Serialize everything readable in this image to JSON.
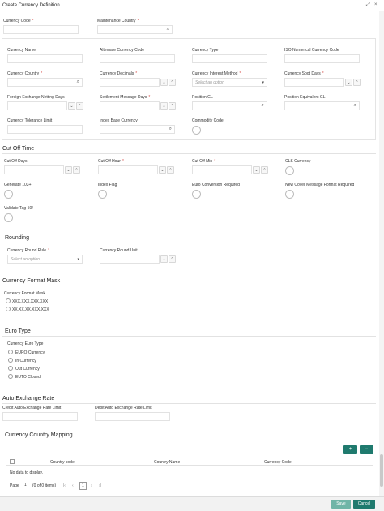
{
  "window": {
    "title": "Create Currency Definition",
    "restore_label": "⤢",
    "close_label": "×"
  },
  "header": {
    "currency_code_label": "Currency Code",
    "maintenance_country_label": "Maintenance Country"
  },
  "general": {
    "currency_name_label": "Currency Name",
    "alternate_currency_code_label": "Alternate Currency Code",
    "currency_type_label": "Currency Type",
    "iso_numerical_code_label": "ISO Numerical Currency Code",
    "currency_country_label": "Currency Country",
    "currency_decimals_label": "Currency Decimals",
    "currency_interest_method_label": "Currency Interest Method",
    "currency_interest_method_placeholder": "Select an option",
    "currency_spot_days_label": "Currency Spot Days",
    "fx_netting_days_label": "Foreign Exchange Netting Days",
    "settlement_message_days_label": "Settlement Message Days",
    "position_gl_label": "Position GL",
    "position_equivalent_gl_label": "Position Equivalent GL",
    "currency_tolerance_limit_label": "Currency Tolerance Limit",
    "index_base_currency_label": "Index Base Currency",
    "commodity_code_label": "Commodity Code"
  },
  "cutoff": {
    "title": "Cut Off Time",
    "cut_off_days_label": "Cut Off Days",
    "cut_off_hour_label": "Cut Off Hour",
    "cut_off_min_label": "Cut Off Min",
    "cls_currency_label": "CLS Currency",
    "generate_103_label": "Generate 103+",
    "index_flag_label": "Index Flag",
    "euro_conversion_label": "Euro Conversion Required",
    "new_cover_label": "New Cover Message Format Required",
    "validate_tag_label": "Validate Tag-50f"
  },
  "rounding": {
    "title": "Rounding",
    "rule_label": "Currency Round Rule",
    "rule_placeholder": "Select an option",
    "unit_label": "Currency Round Unit"
  },
  "format_mask": {
    "title": "Currency Format Mask",
    "field_label": "Currency Format Mask",
    "options": [
      "XXX,XXX,XXX.XXX",
      "XX,XX,XX,XXX.XXX"
    ]
  },
  "euro": {
    "title": "Euro Type",
    "field_label": "Currency Euro Type",
    "options": [
      "EURO Currency",
      "In Currency",
      "Out Currency",
      "EUTO Closed"
    ]
  },
  "auto_exchange": {
    "title": "Auto Exchange Rate",
    "credit_label": "Credit Auto Exchange Rate Limit",
    "debit_label": "Debit Auto Exchange Rate Limit"
  },
  "mapping": {
    "title": "Currency Country Mapping",
    "add_label": "+",
    "remove_label": "−",
    "columns": [
      "Country code",
      "Country Name",
      "Currency Code"
    ],
    "empty_text": "No data to display.",
    "page_label": "Page",
    "page_value": "1",
    "page_info": "(0 of 0 items)",
    "current_page": "1"
  },
  "footer": {
    "save_label": "Save",
    "cancel_label": "Cancel"
  },
  "colors": {
    "accent": "#1f7a6e",
    "required": "#d9534f"
  },
  "icons": {
    "search": "search-icon",
    "chevron": "chevron-down-icon"
  }
}
